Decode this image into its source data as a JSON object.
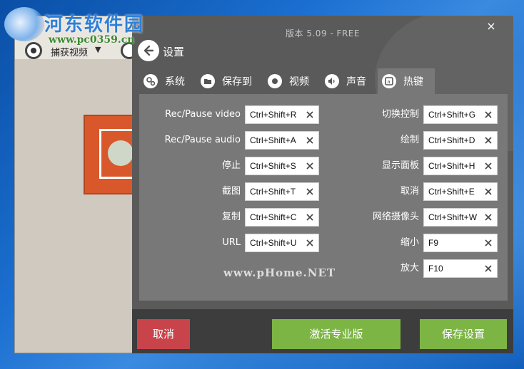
{
  "watermark": {
    "site": "河东软件园",
    "url": "www.pc0359.cn",
    "overlay": "www.pHome.NET"
  },
  "background_window": {
    "capture_label": "捕获视频",
    "dropdown": "▼"
  },
  "window": {
    "title": "版本 5.09 - FREE",
    "close": "×"
  },
  "header": {
    "back_label": "设置"
  },
  "tabs": [
    {
      "label": "系统",
      "icon": "gears-icon"
    },
    {
      "label": "保存到",
      "icon": "folder-icon"
    },
    {
      "label": "视频",
      "icon": "record-icon"
    },
    {
      "label": "声音",
      "icon": "speaker-icon"
    },
    {
      "label": "热键",
      "icon": "keyboard-icon",
      "active": true
    }
  ],
  "hotkeys": {
    "left": [
      {
        "label": "Rec/Pause video",
        "value": "Ctrl+Shift+R"
      },
      {
        "label": "Rec/Pause audio",
        "value": "Ctrl+Shift+A"
      },
      {
        "label": "停止",
        "value": "Ctrl+Shift+S"
      },
      {
        "label": "截图",
        "value": "Ctrl+Shift+T"
      },
      {
        "label": "复制",
        "value": "Ctrl+Shift+C"
      },
      {
        "label": "URL",
        "value": "Ctrl+Shift+U"
      }
    ],
    "right": [
      {
        "label": "切换控制",
        "value": "Ctrl+Shift+G"
      },
      {
        "label": "绘制",
        "value": "Ctrl+Shift+D"
      },
      {
        "label": "显示面板",
        "value": "Ctrl+Shift+H"
      },
      {
        "label": "取消",
        "value": "Ctrl+Shift+E"
      },
      {
        "label": "网络摄像头",
        "value": "Ctrl+Shift+W"
      },
      {
        "label": "缩小",
        "value": "F9"
      },
      {
        "label": "放大",
        "value": "F10"
      }
    ]
  },
  "footer": {
    "cancel_label": "取消",
    "activate_label": "激活专业版",
    "save_label": "保存设置"
  },
  "colors": {
    "cancel": "#c9444a",
    "accent_green": "#7db545",
    "panel": "#787878"
  }
}
